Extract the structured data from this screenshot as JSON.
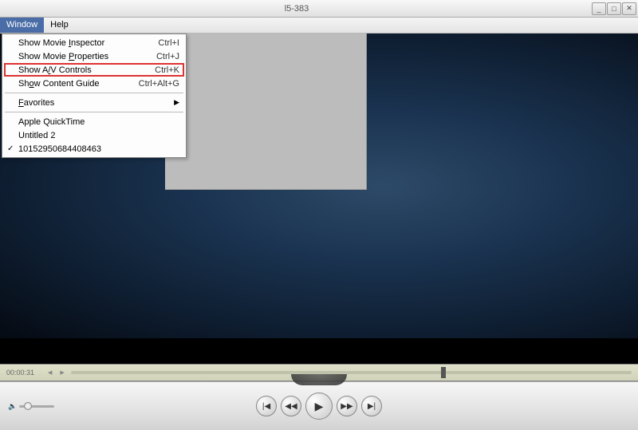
{
  "title_suffix": "l5-383",
  "menubar": {
    "window": "Window",
    "help": "Help"
  },
  "dropdown": {
    "items": [
      {
        "label": "Show Movie Inspector",
        "mnemonic": "I",
        "shortcut": "Ctrl+I"
      },
      {
        "label": "Show Movie Properties",
        "mnemonic": "P",
        "shortcut": "Ctrl+J"
      },
      {
        "label": "Show A/V Controls",
        "mnemonic": "/",
        "shortcut": "Ctrl+K",
        "highlighted": true
      },
      {
        "label": "Show Content Guide",
        "mnemonic": "o",
        "shortcut": "Ctrl+Alt+G"
      }
    ],
    "favorites": "Favorites",
    "recent": [
      {
        "label": "Apple QuickTime"
      },
      {
        "label": "Untitled 2"
      },
      {
        "label": "10152950684408463",
        "checked": true
      }
    ]
  },
  "playback": {
    "current_time": "00:00:31"
  },
  "transport": {
    "skip_back": "|◀",
    "rewind": "◀◀",
    "play": "▶",
    "forward": "▶▶",
    "skip_fwd": "▶|"
  },
  "window_controls": {
    "min": "_",
    "max": "□",
    "close": "✕"
  }
}
